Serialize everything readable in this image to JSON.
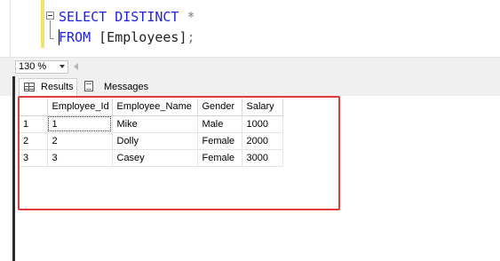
{
  "editor": {
    "line1": {
      "keyword": "SELECT DISTINCT",
      "star": "*"
    },
    "line2": {
      "keyword": "FROM",
      "table": "[Employees]",
      "semicolon": ";"
    }
  },
  "zoom": {
    "value": "130 %"
  },
  "tabs": [
    {
      "label": "Results",
      "icon": "grid-icon"
    },
    {
      "label": "Messages",
      "icon": "messages-icon"
    }
  ],
  "grid": {
    "columns": [
      "Employee_Id",
      "Employee_Name",
      "Gender",
      "Salary"
    ],
    "rows": [
      {
        "num": "1",
        "cells": [
          "1",
          "Mike",
          "Male",
          "1000"
        ]
      },
      {
        "num": "2",
        "cells": [
          "2",
          "Dolly",
          "Female",
          "2000"
        ]
      },
      {
        "num": "3",
        "cells": [
          "3",
          "Casey",
          "Female",
          "3000"
        ]
      }
    ]
  },
  "colors": {
    "keyword": "#1e22e0",
    "operator": "#7f7f7f",
    "highlight": "#e03c3c"
  }
}
